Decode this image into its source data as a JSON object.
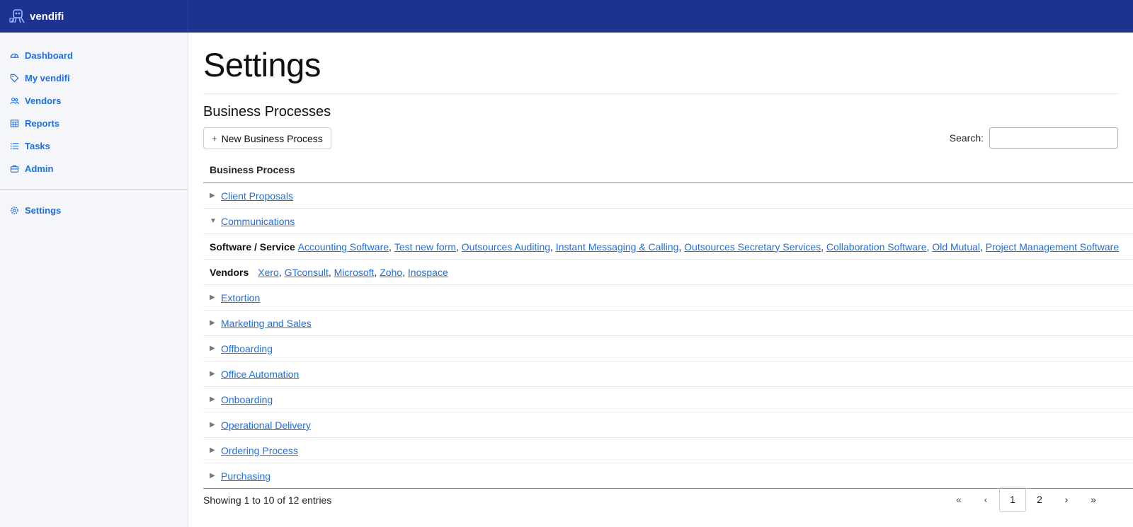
{
  "brand": {
    "name": "vendifi"
  },
  "sidebar": {
    "items": [
      {
        "label": "Dashboard",
        "icon": "dashboard-icon"
      },
      {
        "label": "My vendifi",
        "icon": "tag-icon"
      },
      {
        "label": "Vendors",
        "icon": "people-icon"
      },
      {
        "label": "Reports",
        "icon": "report-icon"
      },
      {
        "label": "Tasks",
        "icon": "list-icon"
      },
      {
        "label": "Admin",
        "icon": "briefcase-icon"
      }
    ],
    "settings_label": "Settings"
  },
  "page": {
    "title": "Settings",
    "section_title": "Business Processes",
    "new_button_label": "New Business Process",
    "search_label": "Search:",
    "search_value": ""
  },
  "table": {
    "header": "Business Process",
    "rows": [
      {
        "name": "Client Proposals",
        "expanded": false
      },
      {
        "name": "Communications",
        "expanded": true
      },
      {
        "name": "Extortion",
        "expanded": false
      },
      {
        "name": "Marketing and Sales",
        "expanded": false
      },
      {
        "name": "Offboarding",
        "expanded": false
      },
      {
        "name": "Office Automation",
        "expanded": false
      },
      {
        "name": "Onboarding",
        "expanded": false
      },
      {
        "name": "Operational Delivery",
        "expanded": false
      },
      {
        "name": "Ordering Process",
        "expanded": false
      },
      {
        "name": "Purchasing",
        "expanded": false
      }
    ],
    "detail": {
      "software_label": "Software / Service",
      "software": [
        "Accounting Software",
        "Test new form",
        "Outsources Auditing",
        "Instant Messaging & Calling",
        "Outsources Secretary Services",
        "Collaboration Software",
        "Old Mutual",
        "Project Management Software"
      ],
      "vendors_label": "Vendors",
      "vendors": [
        "Xero",
        "GTconsult",
        "Microsoft",
        "Zoho",
        "Inospace"
      ]
    }
  },
  "footer": {
    "info": "Showing 1 to 10 of 12 entries",
    "pager": {
      "first": "«",
      "prev": "‹",
      "pages": [
        "1",
        "2"
      ],
      "active": "1",
      "next": "›",
      "last": "»"
    }
  },
  "colors": {
    "topbar": "#1e3390",
    "link": "#1f6fe0",
    "sidebar_bg": "#f4f6fa"
  }
}
